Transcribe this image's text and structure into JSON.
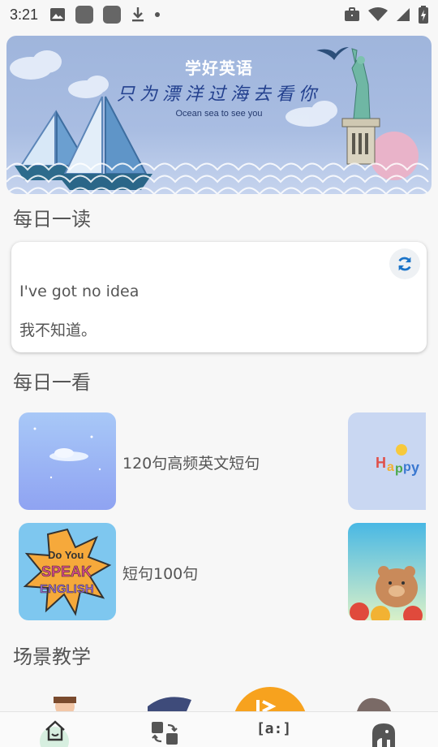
{
  "status_bar": {
    "time": "3:21",
    "icons": [
      "image-icon",
      "app-square-icon",
      "app-square-icon",
      "download-icon",
      "dot-icon",
      "briefcase-icon",
      "wifi-icon",
      "signal-icon",
      "battery-charging-icon"
    ]
  },
  "banner": {
    "title": "学好英语",
    "subtitle": "只为漂洋过海去看你",
    "caption": "Ocean sea to see you"
  },
  "daily_read": {
    "title": "每日一读",
    "english": "I've got no idea",
    "chinese": "我不知道。",
    "refresh_icon": "refresh-icon"
  },
  "daily_look": {
    "title": "每日一看",
    "items": [
      {
        "label": "120句高频英文短句"
      },
      {
        "label": "短句100句"
      }
    ]
  },
  "scene_teaching": {
    "title": "场景教学"
  },
  "bottom_nav": {
    "items": [
      {
        "icon": "home-icon",
        "active": true
      },
      {
        "icon": "translate-icon",
        "active": false
      },
      {
        "icon": "phonetic-icon",
        "text": "[a:]",
        "active": false
      },
      {
        "icon": "elephant-icon",
        "active": false
      }
    ]
  },
  "colors": {
    "accent": "#1a73c8",
    "nav_active_bg": "#d7efe0",
    "banner_bg": "#a9bde2"
  }
}
